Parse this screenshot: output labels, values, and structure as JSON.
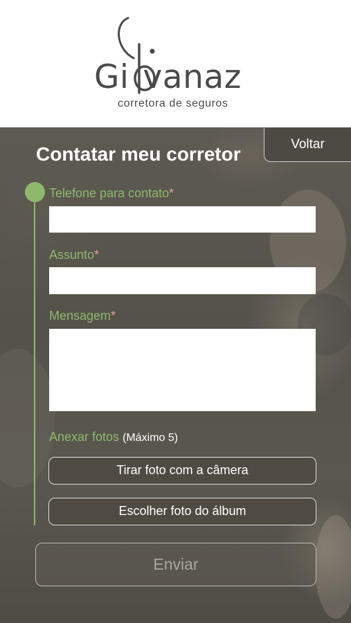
{
  "brand": {
    "name_left": "Gi",
    "name_right": "vanaz",
    "tagline": "corretora de seguros"
  },
  "page": {
    "title": "Contatar meu corretor",
    "back_label": "Voltar"
  },
  "form": {
    "phone": {
      "label": "Telefone para contato",
      "required_mark": "*",
      "value": ""
    },
    "subject": {
      "label": "Assunto",
      "required_mark": "*",
      "value": ""
    },
    "message": {
      "label": "Mensagem",
      "required_mark": "*",
      "value": ""
    },
    "attach": {
      "label": "Anexar fotos",
      "note": "(Máximo 5)"
    },
    "camera_button": "Tirar foto com a câmera",
    "album_button": "Escolher foto do álbum",
    "submit_label": "Enviar"
  },
  "colors": {
    "accent_green": "#8eb96d",
    "required_pink": "#e6a0a0",
    "logo_gray": "#4a4a48",
    "panel_dark": "#4f4b43"
  }
}
